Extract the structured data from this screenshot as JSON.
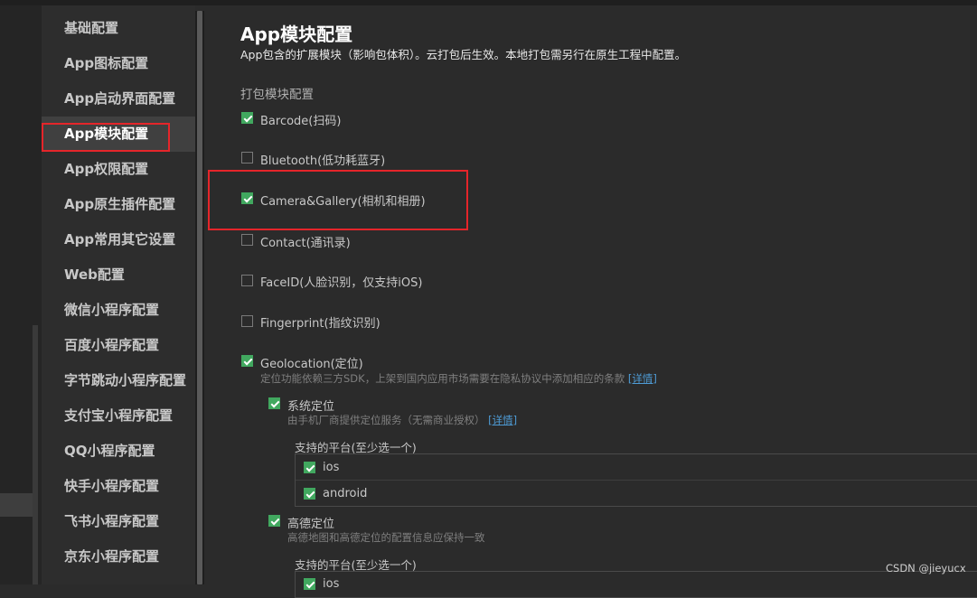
{
  "nav": {
    "items": [
      {
        "label": "基础配置",
        "active": false
      },
      {
        "label": "App图标配置",
        "active": false
      },
      {
        "label": "App启动界面配置",
        "active": false
      },
      {
        "label": "App模块配置",
        "active": true
      },
      {
        "label": "App权限配置",
        "active": false
      },
      {
        "label": "App原生插件配置",
        "active": false
      },
      {
        "label": "App常用其它设置",
        "active": false
      },
      {
        "label": "Web配置",
        "active": false
      },
      {
        "label": "微信小程序配置",
        "active": false
      },
      {
        "label": "百度小程序配置",
        "active": false
      },
      {
        "label": "字节跳动小程序配置",
        "active": false
      },
      {
        "label": "支付宝小程序配置",
        "active": false
      },
      {
        "label": "QQ小程序配置",
        "active": false
      },
      {
        "label": "快手小程序配置",
        "active": false
      },
      {
        "label": "飞书小程序配置",
        "active": false
      },
      {
        "label": "京东小程序配置",
        "active": false
      }
    ]
  },
  "page": {
    "title": "App模块配置",
    "description": "App包含的扩展模块（影响包体积）。云打包后生效。本地打包需另行在原生工程中配置。",
    "section_title": "打包模块配置"
  },
  "modules": [
    {
      "label": "Barcode(扫码)",
      "checked": true
    },
    {
      "label": "Bluetooth(低功耗蓝牙)",
      "checked": false
    },
    {
      "label": "Camera&Gallery(相机和相册)",
      "checked": true
    },
    {
      "label": "Contact(通讯录)",
      "checked": false
    },
    {
      "label": "FaceID(人脸识别，仅支持iOS)",
      "checked": false
    },
    {
      "label": "Fingerprint(指纹识别)",
      "checked": false
    },
    {
      "label": "Geolocation(定位)",
      "checked": true,
      "desc": "定位功能依赖三方SDK，上架到国内应用市场需要在隐私协议中添加相应的条款",
      "link": "[详情]"
    }
  ],
  "geolocation": {
    "system": {
      "label": "系统定位",
      "checked": true,
      "desc": "由手机厂商提供定位服务（无需商业授权）",
      "link": "[详情]",
      "platforms_title": "支持的平台(至少选一个)",
      "platforms": [
        {
          "label": "ios",
          "checked": true
        },
        {
          "label": "android",
          "checked": true
        }
      ]
    },
    "amap": {
      "label": "高德定位",
      "checked": true,
      "desc": "高德地图和高德定位的配置信息应保持一致",
      "platforms_title": "支持的平台(至少选一个)",
      "platforms": [
        {
          "label": "ios",
          "checked": true
        }
      ]
    }
  },
  "watermark": "CSDN @jieyucx",
  "colors": {
    "checkbox": "#41a85f",
    "highlight": "#e5252a",
    "link": "#4e9cd6"
  }
}
